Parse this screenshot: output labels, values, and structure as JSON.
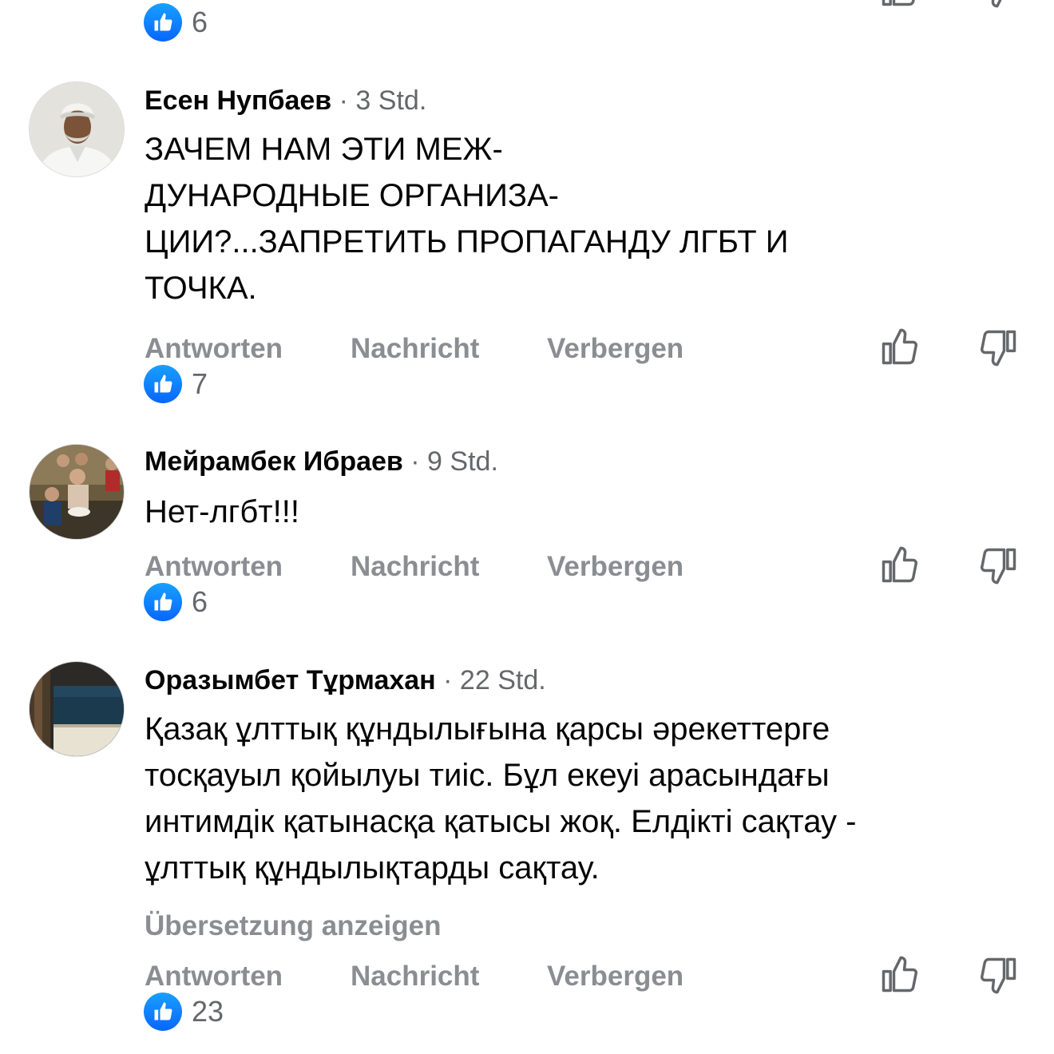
{
  "top_fragment": {
    "reaction_count": "6"
  },
  "actions": {
    "reply": "Antworten",
    "message": "Nachricht",
    "hide": "Verbergen",
    "translate": "Übersetzung anzeigen"
  },
  "icons": {
    "like": "thumbs-up-icon",
    "dislike": "thumbs-down-icon",
    "reaction": "like-reaction-icon"
  },
  "colors": {
    "like_blue": "#0866ff",
    "muted_text": "#65676b",
    "action_text": "#8a8d91"
  },
  "comments": [
    {
      "author": "Есен Нупбаев",
      "time": "· 3 Std.",
      "text": "ЗАЧЕМ НАМ ЭТИ МЕЖ-\nДУНАРОДНЫЕ ОРГАНИЗА-\nЦИИ?...ЗАПРЕТИТЬ ПРОПАГАНДУ ЛГБТ И\nТОЧКА.",
      "reaction_count": "7"
    },
    {
      "author": "Мейрамбек Ибраев",
      "time": "· 9 Std.",
      "text": "Нет-лгбт!!!",
      "reaction_count": "6"
    },
    {
      "author": "Оразымбет Тұрмахан",
      "time": "· 22 Std.",
      "text": "Қазақ ұлттық құндылығына қарсы әрекеттерге\nтосқауыл қойылуы тиіс. Бұл екеуі арасындағы\nинтимдік қатынасқа қатысы жоқ. Елдікті сақтау -\nұлттық құндылықтарды сақтау.",
      "reaction_count": "23"
    }
  ]
}
